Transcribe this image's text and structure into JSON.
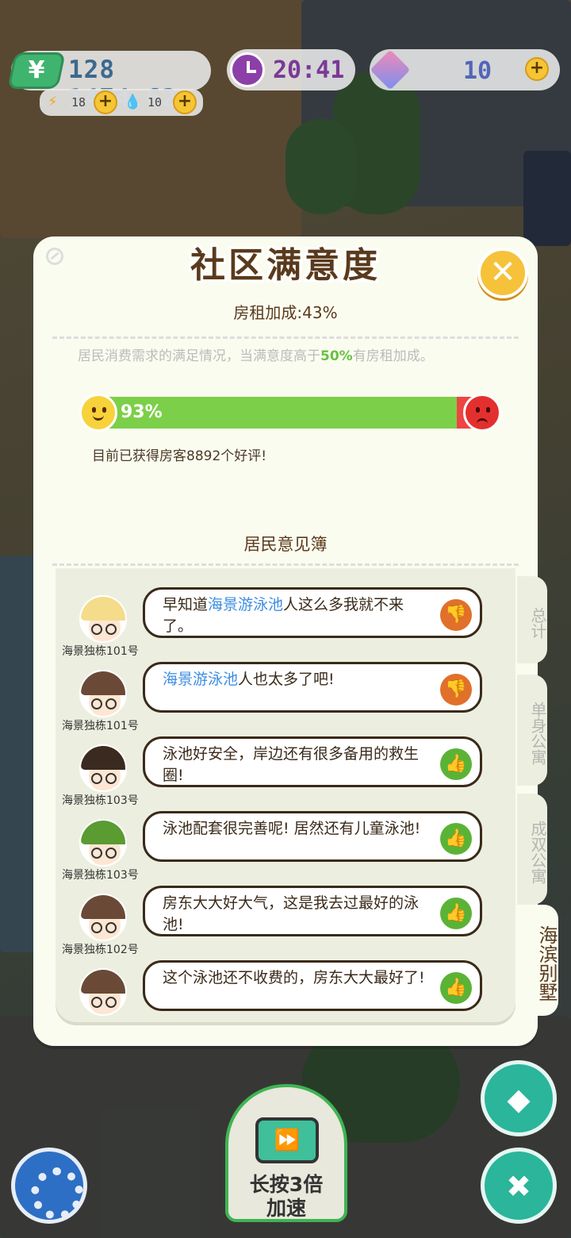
{
  "hud": {
    "money": "128 1474.62",
    "energy": "18",
    "water": "10",
    "time": "20:41",
    "gems": "10"
  },
  "panel": {
    "title": "社区满意度",
    "rent_bonus": "房租加成:43%",
    "description_pre": "居民消费需求的满足情况，当满意度高于",
    "description_threshold": "50%",
    "description_post": "有房租加成。",
    "satisfaction_label": "93%",
    "satisfaction_value": 0.93,
    "reviews_text": "目前已获得房客8892个好评!",
    "book_title": "居民意见簿"
  },
  "comments": [
    {
      "unit": "海景独栋101号",
      "pre": "早知道",
      "place": "海景游泳池",
      "post": "人这么多我就不来了。",
      "rating": "bad"
    },
    {
      "unit": "海景独栋101号",
      "pre": "",
      "place": "海景游泳池",
      "post": "人也太多了吧!",
      "rating": "bad"
    },
    {
      "unit": "海景独栋103号",
      "pre": "泳池好安全，岸边还有很多备用的救生圈!",
      "place": "",
      "post": "",
      "rating": "good"
    },
    {
      "unit": "海景独栋103号",
      "pre": "泳池配套很完善呢! 居然还有儿童泳池!",
      "place": "",
      "post": "",
      "rating": "good"
    },
    {
      "unit": "海景独栋102号",
      "pre": "房东大大好大气，这是我去过最好的泳池!",
      "place": "",
      "post": "",
      "rating": "good"
    },
    {
      "unit": "",
      "pre": "这个泳池还不收费的，房东大大最好了!",
      "place": "",
      "post": "",
      "rating": "good"
    }
  ],
  "tabs": [
    "总计",
    "单身公寓",
    "成双公寓",
    "海滨别墅"
  ],
  "active_tab": "海滨别墅",
  "bottom": {
    "speed_label_line1": "长按3倍",
    "speed_label_line2": "加速"
  },
  "colors": {
    "accent_green": "#7ccf48",
    "angry_red": "#e3302e",
    "place_blue": "#3e8de0",
    "good_thumb": "#5bb336",
    "bad_thumb": "#e0702a"
  }
}
